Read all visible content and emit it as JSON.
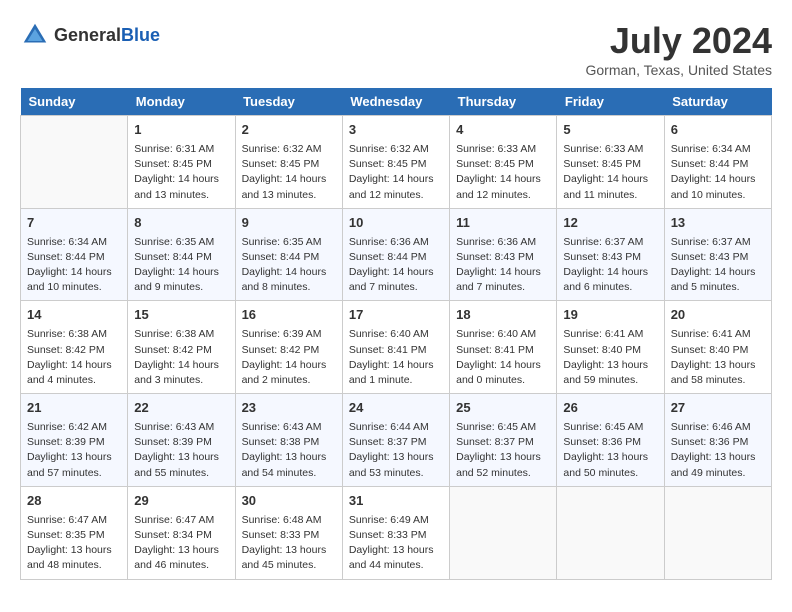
{
  "header": {
    "logo_general": "General",
    "logo_blue": "Blue",
    "month_year": "July 2024",
    "location": "Gorman, Texas, United States"
  },
  "days_of_week": [
    "Sunday",
    "Monday",
    "Tuesday",
    "Wednesday",
    "Thursday",
    "Friday",
    "Saturday"
  ],
  "weeks": [
    [
      {
        "day": "",
        "content": ""
      },
      {
        "day": "1",
        "content": "Sunrise: 6:31 AM\nSunset: 8:45 PM\nDaylight: 14 hours\nand 13 minutes."
      },
      {
        "day": "2",
        "content": "Sunrise: 6:32 AM\nSunset: 8:45 PM\nDaylight: 14 hours\nand 13 minutes."
      },
      {
        "day": "3",
        "content": "Sunrise: 6:32 AM\nSunset: 8:45 PM\nDaylight: 14 hours\nand 12 minutes."
      },
      {
        "day": "4",
        "content": "Sunrise: 6:33 AM\nSunset: 8:45 PM\nDaylight: 14 hours\nand 12 minutes."
      },
      {
        "day": "5",
        "content": "Sunrise: 6:33 AM\nSunset: 8:45 PM\nDaylight: 14 hours\nand 11 minutes."
      },
      {
        "day": "6",
        "content": "Sunrise: 6:34 AM\nSunset: 8:44 PM\nDaylight: 14 hours\nand 10 minutes."
      }
    ],
    [
      {
        "day": "7",
        "content": "Sunrise: 6:34 AM\nSunset: 8:44 PM\nDaylight: 14 hours\nand 10 minutes."
      },
      {
        "day": "8",
        "content": "Sunrise: 6:35 AM\nSunset: 8:44 PM\nDaylight: 14 hours\nand 9 minutes."
      },
      {
        "day": "9",
        "content": "Sunrise: 6:35 AM\nSunset: 8:44 PM\nDaylight: 14 hours\nand 8 minutes."
      },
      {
        "day": "10",
        "content": "Sunrise: 6:36 AM\nSunset: 8:44 PM\nDaylight: 14 hours\nand 7 minutes."
      },
      {
        "day": "11",
        "content": "Sunrise: 6:36 AM\nSunset: 8:43 PM\nDaylight: 14 hours\nand 7 minutes."
      },
      {
        "day": "12",
        "content": "Sunrise: 6:37 AM\nSunset: 8:43 PM\nDaylight: 14 hours\nand 6 minutes."
      },
      {
        "day": "13",
        "content": "Sunrise: 6:37 AM\nSunset: 8:43 PM\nDaylight: 14 hours\nand 5 minutes."
      }
    ],
    [
      {
        "day": "14",
        "content": "Sunrise: 6:38 AM\nSunset: 8:42 PM\nDaylight: 14 hours\nand 4 minutes."
      },
      {
        "day": "15",
        "content": "Sunrise: 6:38 AM\nSunset: 8:42 PM\nDaylight: 14 hours\nand 3 minutes."
      },
      {
        "day": "16",
        "content": "Sunrise: 6:39 AM\nSunset: 8:42 PM\nDaylight: 14 hours\nand 2 minutes."
      },
      {
        "day": "17",
        "content": "Sunrise: 6:40 AM\nSunset: 8:41 PM\nDaylight: 14 hours\nand 1 minute."
      },
      {
        "day": "18",
        "content": "Sunrise: 6:40 AM\nSunset: 8:41 PM\nDaylight: 14 hours\nand 0 minutes."
      },
      {
        "day": "19",
        "content": "Sunrise: 6:41 AM\nSunset: 8:40 PM\nDaylight: 13 hours\nand 59 minutes."
      },
      {
        "day": "20",
        "content": "Sunrise: 6:41 AM\nSunset: 8:40 PM\nDaylight: 13 hours\nand 58 minutes."
      }
    ],
    [
      {
        "day": "21",
        "content": "Sunrise: 6:42 AM\nSunset: 8:39 PM\nDaylight: 13 hours\nand 57 minutes."
      },
      {
        "day": "22",
        "content": "Sunrise: 6:43 AM\nSunset: 8:39 PM\nDaylight: 13 hours\nand 55 minutes."
      },
      {
        "day": "23",
        "content": "Sunrise: 6:43 AM\nSunset: 8:38 PM\nDaylight: 13 hours\nand 54 minutes."
      },
      {
        "day": "24",
        "content": "Sunrise: 6:44 AM\nSunset: 8:37 PM\nDaylight: 13 hours\nand 53 minutes."
      },
      {
        "day": "25",
        "content": "Sunrise: 6:45 AM\nSunset: 8:37 PM\nDaylight: 13 hours\nand 52 minutes."
      },
      {
        "day": "26",
        "content": "Sunrise: 6:45 AM\nSunset: 8:36 PM\nDaylight: 13 hours\nand 50 minutes."
      },
      {
        "day": "27",
        "content": "Sunrise: 6:46 AM\nSunset: 8:36 PM\nDaylight: 13 hours\nand 49 minutes."
      }
    ],
    [
      {
        "day": "28",
        "content": "Sunrise: 6:47 AM\nSunset: 8:35 PM\nDaylight: 13 hours\nand 48 minutes."
      },
      {
        "day": "29",
        "content": "Sunrise: 6:47 AM\nSunset: 8:34 PM\nDaylight: 13 hours\nand 46 minutes."
      },
      {
        "day": "30",
        "content": "Sunrise: 6:48 AM\nSunset: 8:33 PM\nDaylight: 13 hours\nand 45 minutes."
      },
      {
        "day": "31",
        "content": "Sunrise: 6:49 AM\nSunset: 8:33 PM\nDaylight: 13 hours\nand 44 minutes."
      },
      {
        "day": "",
        "content": ""
      },
      {
        "day": "",
        "content": ""
      },
      {
        "day": "",
        "content": ""
      }
    ]
  ]
}
